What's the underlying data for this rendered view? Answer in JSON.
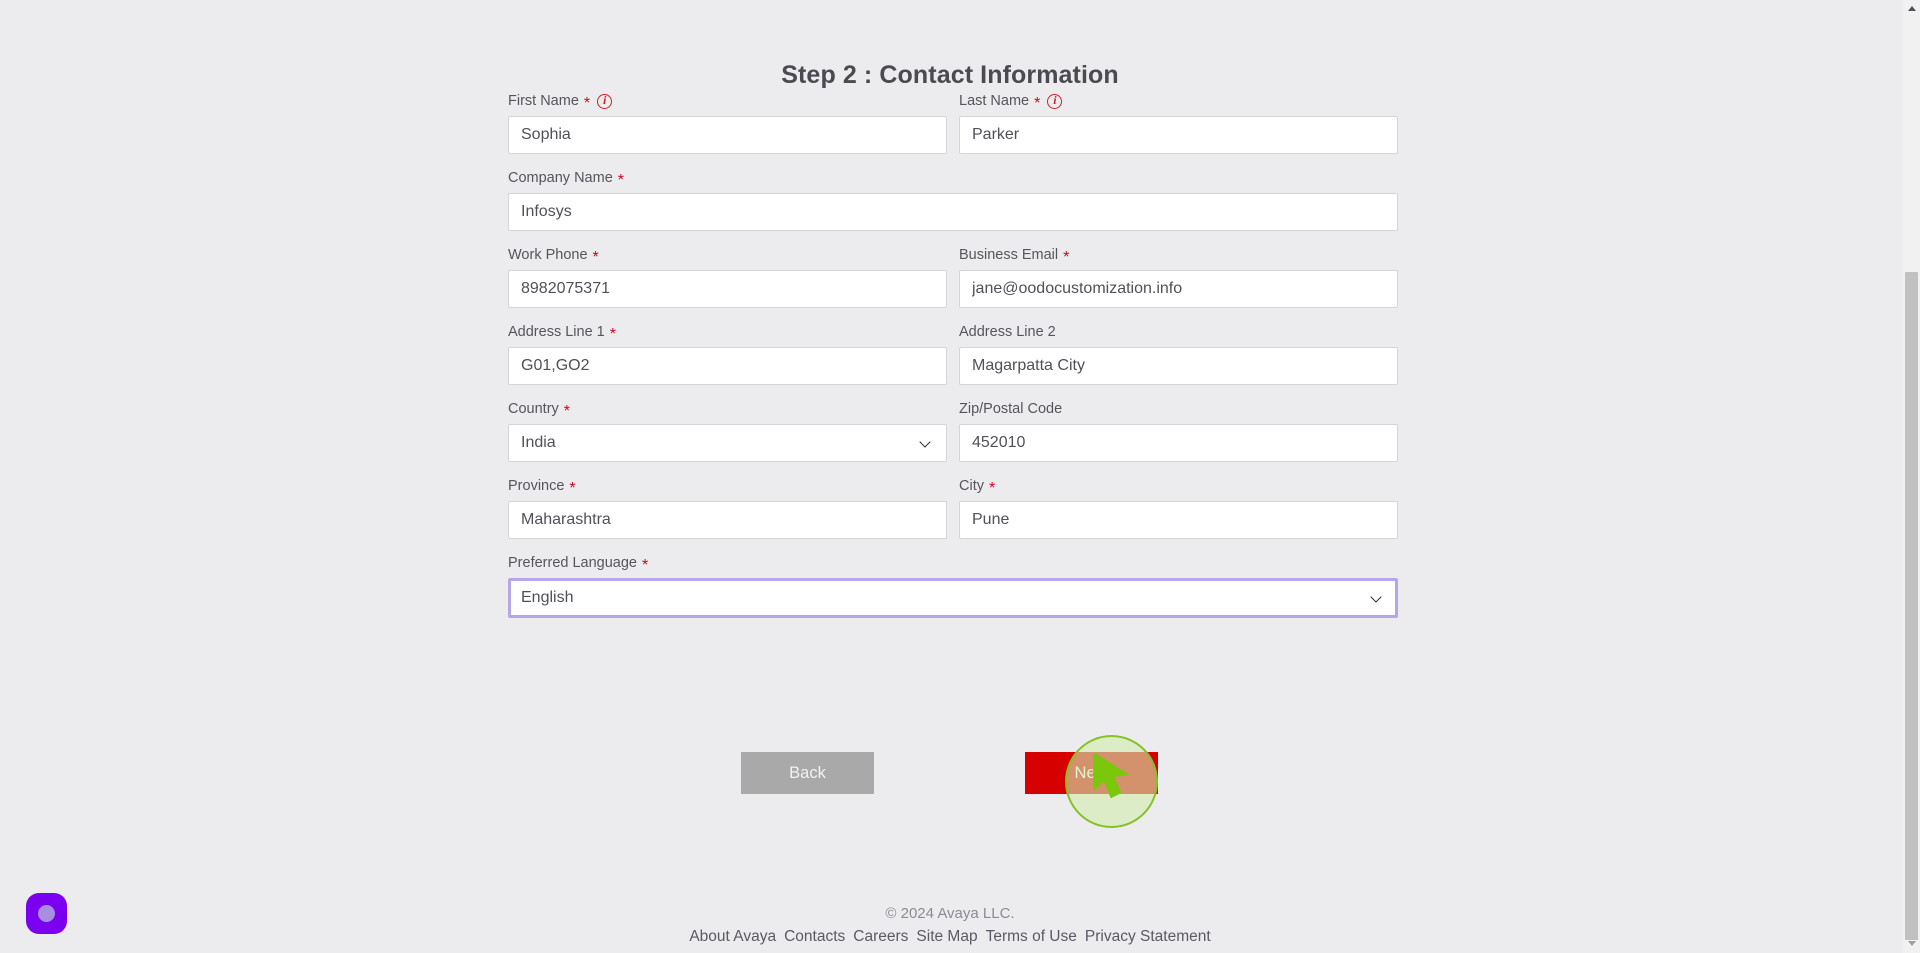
{
  "page": {
    "title": "Step 2 : Contact Information",
    "background_color": "#ececee"
  },
  "form": {
    "rows": [
      {
        "fields": [
          {
            "label": "First Name",
            "required": true,
            "info_icon": "info-circle-icon",
            "type": "text",
            "value": "Sophia",
            "name": "first-name"
          },
          {
            "label": "Last Name",
            "required": true,
            "info_icon": "info-circle-icon",
            "type": "text",
            "value": "Parker",
            "name": "last-name"
          }
        ]
      },
      {
        "fields": [
          {
            "label": "Company Name",
            "required": true,
            "type": "text",
            "value": "Infosys",
            "name": "company-name"
          }
        ]
      },
      {
        "fields": [
          {
            "label": "Work Phone",
            "required": true,
            "type": "text",
            "value": "8982075371",
            "name": "work-phone"
          },
          {
            "label": "Business Email",
            "required": true,
            "type": "text",
            "value": "jane@oodocustomization.info",
            "name": "business-email"
          }
        ]
      },
      {
        "fields": [
          {
            "label": "Address Line 1",
            "required": true,
            "type": "text",
            "value": "G01,GO2",
            "name": "address-line-1"
          },
          {
            "label": "Address Line 2",
            "required": false,
            "type": "text",
            "value": "Magarpatta City",
            "name": "address-line-2"
          }
        ]
      },
      {
        "fields": [
          {
            "label": "Country",
            "required": true,
            "type": "select",
            "value": "India",
            "name": "country"
          },
          {
            "label": "Zip/Postal Code",
            "required": false,
            "type": "text",
            "value": "452010",
            "name": "zip-postal-code"
          }
        ]
      },
      {
        "fields": [
          {
            "label": "Province",
            "required": true,
            "type": "text",
            "value": "Maharashtra",
            "name": "province"
          },
          {
            "label": "City",
            "required": true,
            "type": "text",
            "value": "Pune",
            "name": "city"
          }
        ]
      },
      {
        "fields": [
          {
            "label": "Preferred Language",
            "required": true,
            "type": "select",
            "value": "English",
            "focused": true,
            "focus_color": "#b6a6e8",
            "name": "preferred-language"
          }
        ]
      }
    ]
  },
  "buttons": {
    "back": {
      "label": "Back",
      "color": "#a9a9a9"
    },
    "next": {
      "label": "Next",
      "color": "#d60000"
    }
  },
  "cursor": {
    "highlight_color": "#86c224",
    "glyph": "mouse-pointer-icon"
  },
  "footer": {
    "copyright": "© 2024 Avaya LLC.",
    "links": [
      "About Avaya",
      "Contacts",
      "Careers",
      "Site Map",
      "Terms of Use",
      "Privacy Statement"
    ]
  },
  "chat_widget": {
    "color": "#7c00f0",
    "icon": "chat-bubble-icon"
  }
}
